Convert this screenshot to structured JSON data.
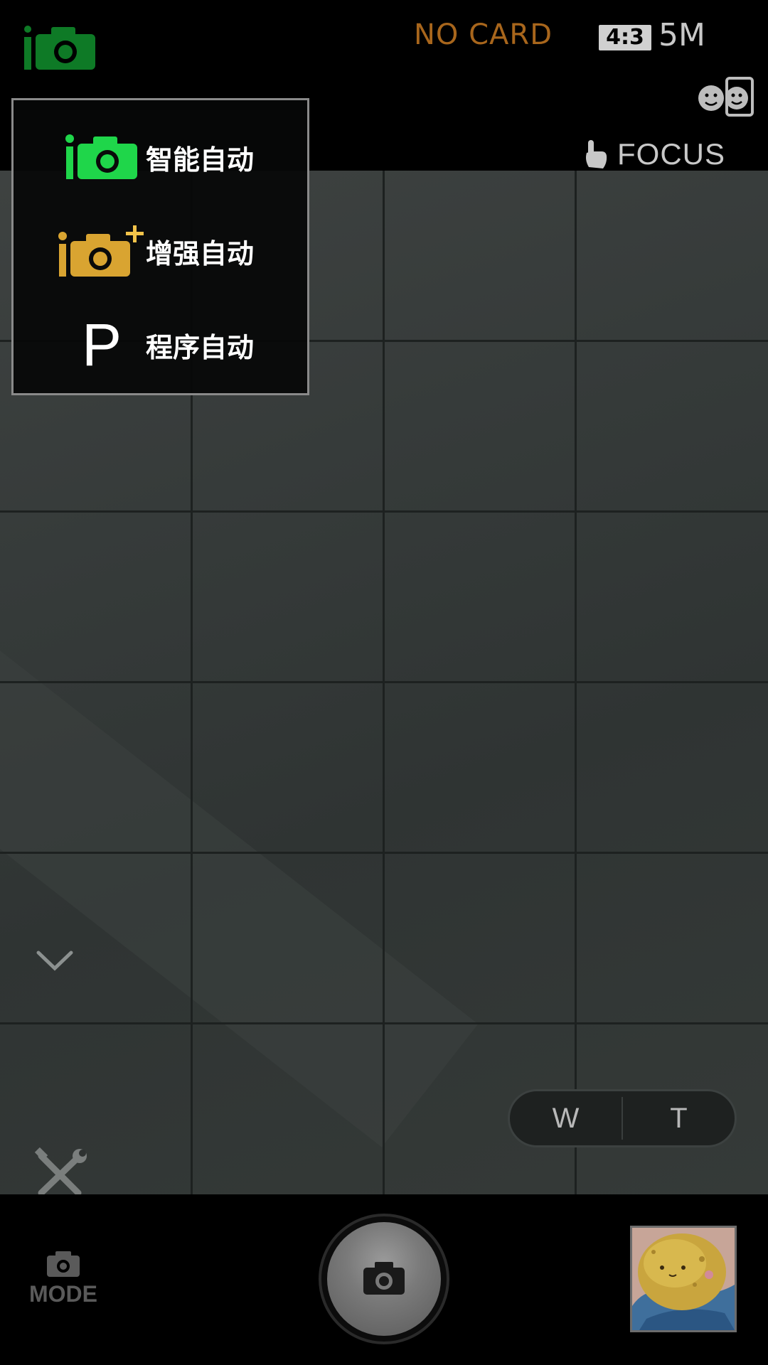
{
  "status_bar": {
    "current_mode_icon": "intelligent-auto-icon",
    "card_status": "NO CARD",
    "aspect_ratio": "4:3",
    "resolution": "5M",
    "face_detection_icon": "face-detection-icon",
    "focus_label": "FOCUS",
    "focus_icon": "touch-hand-icon"
  },
  "mode_menu": {
    "items": [
      {
        "label": "智能自动",
        "icon": "intelligent-auto-icon",
        "color": "#1fd64a"
      },
      {
        "label": "增强自动",
        "icon": "intelligent-auto-plus-icon",
        "color": "#d9a431"
      },
      {
        "label": "程序自动",
        "icon": "program-p-icon",
        "glyph": "P"
      }
    ]
  },
  "viewfinder": {
    "grid": "3x6",
    "zoom": {
      "wide_label": "W",
      "tele_label": "T"
    },
    "expand_icon": "chevron-down-icon",
    "settings_icon": "wrench-screwdriver-icon"
  },
  "bottom_bar": {
    "mode_button_label": "MODE",
    "mode_button_icon": "camera-icon",
    "shutter_icon": "camera-icon",
    "thumbnail_alt": "last-photo-thumbnail"
  },
  "colors": {
    "accent_green": "#1fd64a",
    "accent_gold": "#d9a431",
    "no_card_orange": "#a8661c"
  }
}
